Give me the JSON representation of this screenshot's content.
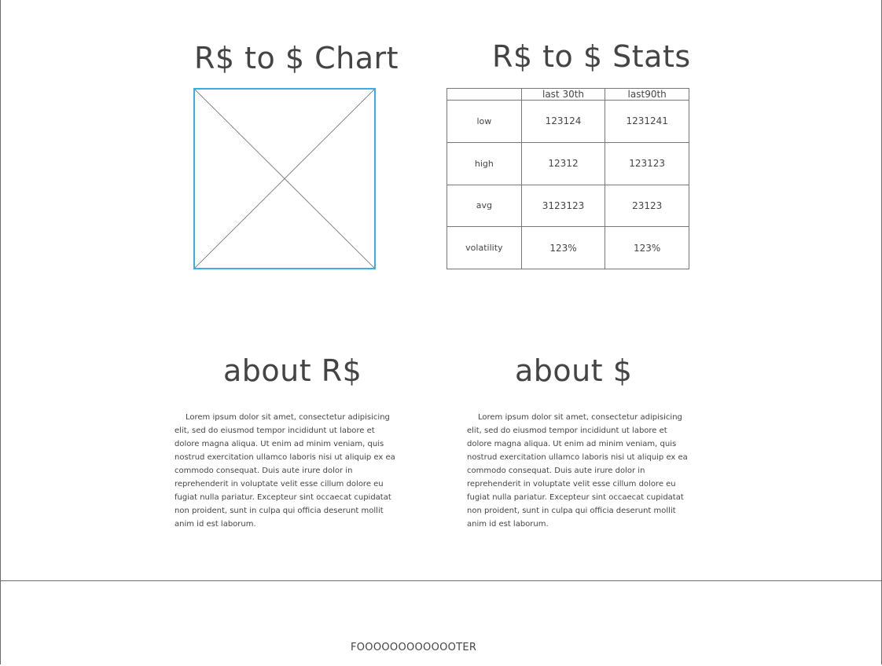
{
  "chart_section": {
    "title": "R$ to $ Chart"
  },
  "stats_section": {
    "title": "R$ to $ Stats",
    "table": {
      "headers": [
        "",
        "last 30th",
        "last90th"
      ],
      "rows": [
        {
          "label": "low",
          "last30": "123124",
          "last90": "1231241"
        },
        {
          "label": "high",
          "last30": "12312",
          "last90": "123123"
        },
        {
          "label": "avg",
          "last30": "3123123",
          "last90": "23123"
        },
        {
          "label": "volatility",
          "last30": "123%",
          "last90": "123%"
        }
      ]
    }
  },
  "about_real": {
    "title": "about R$",
    "text": "Lorem ipsum dolor sit amet, consectetur adipisicing elit, sed do eiusmod tempor incididunt ut labore et dolore magna aliqua. Ut enim ad minim veniam, quis nostrud exercitation ullamco laboris nisi ut aliquip ex ea commodo consequat. Duis aute irure dolor in reprehenderit in voluptate velit esse cillum dolore eu fugiat nulla pariatur. Excepteur sint occaecat cupidatat non proident, sunt in culpa qui officia deserunt mollit anim id est laborum."
  },
  "about_dollar": {
    "title": "about $",
    "text": "Lorem ipsum dolor sit amet, consectetur adipisicing elit, sed do eiusmod tempor incididunt ut labore et dolore magna aliqua. Ut enim ad minim veniam, quis nostrud exercitation ullamco laboris nisi ut aliquip ex ea commodo consequat. Duis aute irure dolor in reprehenderit in voluptate velit esse cillum dolore eu fugiat nulla pariatur. Excepteur sint occaecat cupidatat non proident, sunt in culpa qui officia deserunt mollit anim id est laborum."
  },
  "footer": {
    "text": "FOOOOOOOOOOOOTER"
  },
  "colors": {
    "placeholder_border": "#3aaee0",
    "ink": "#444444",
    "rule": "#6b6b6b"
  }
}
